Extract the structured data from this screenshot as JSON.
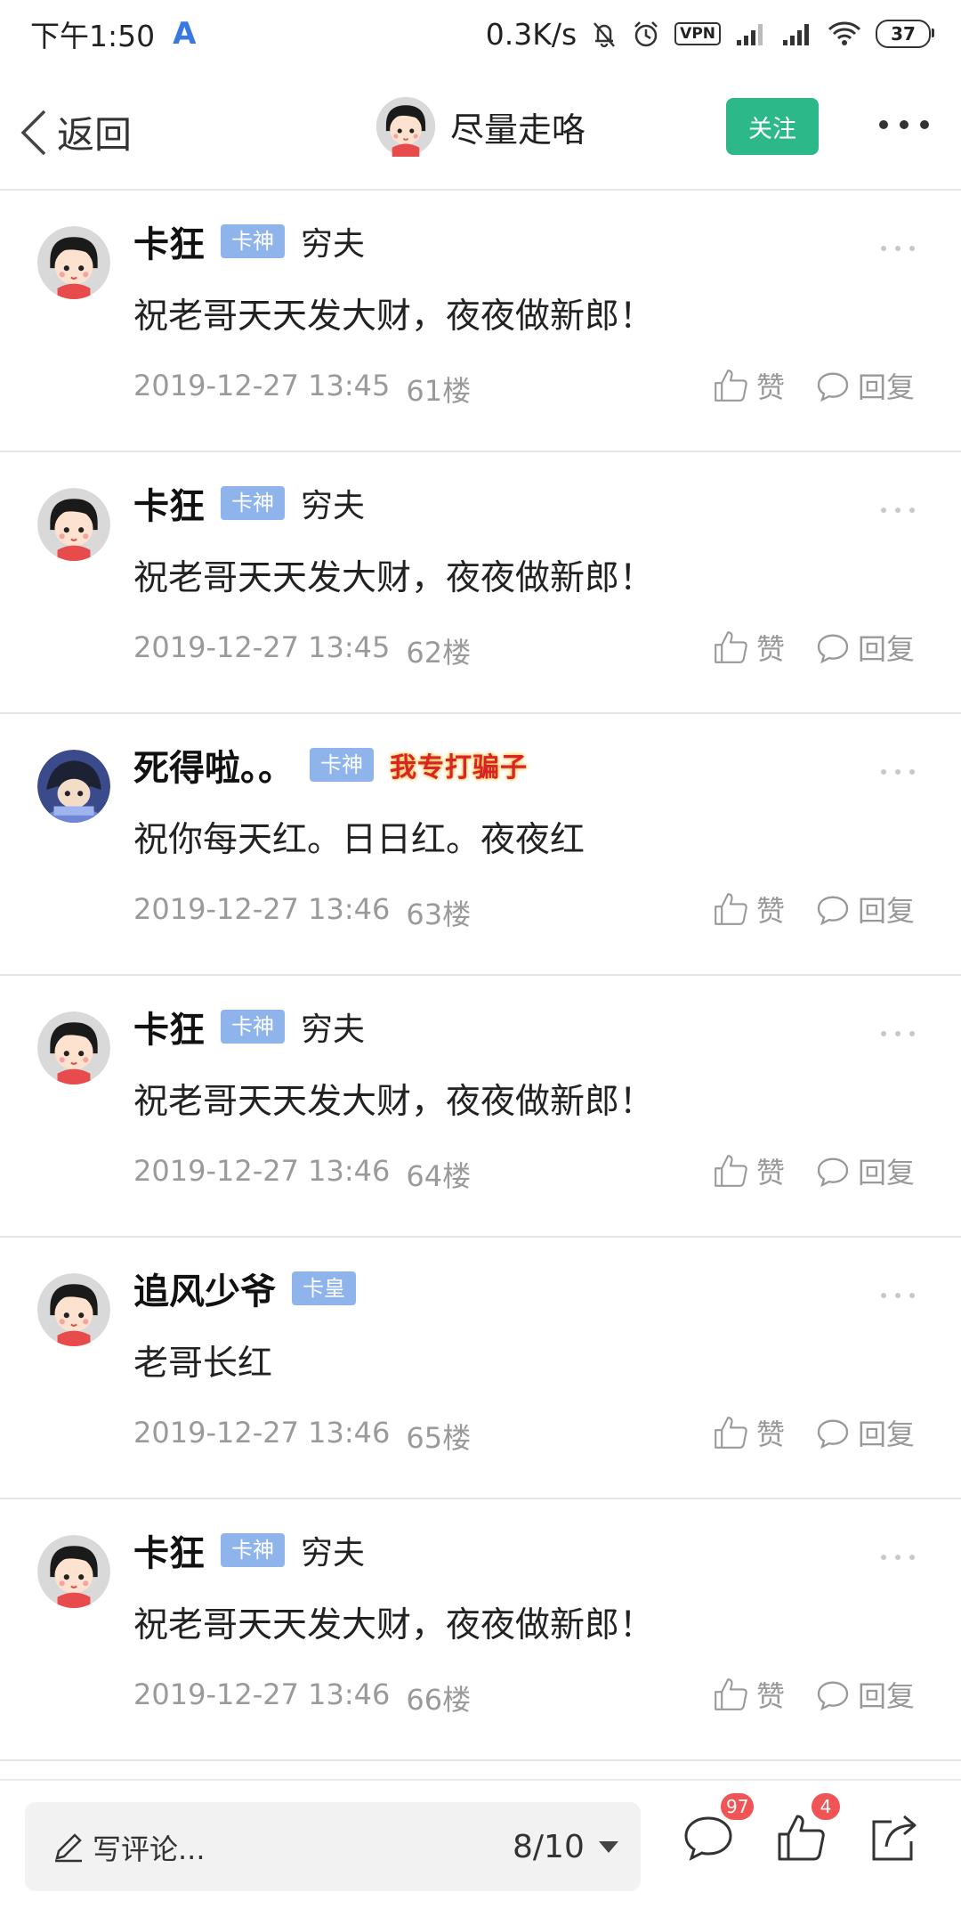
{
  "status_bar": {
    "time": "下午1:50",
    "app_icon": "A",
    "net_speed": "0.3K/s",
    "vpn": "VPN",
    "battery": "37"
  },
  "nav": {
    "back_label": "返回",
    "title": "尽量走咯",
    "follow_label": "关注"
  },
  "comments": [
    {
      "name": "卡狂",
      "badge": "卡神",
      "title": "穷夫",
      "text": "祝老哥天天发大财，夜夜做新郎！",
      "time": "2019-12-27 13:45",
      "floor": "61楼",
      "like": "赞",
      "reply": "回复"
    },
    {
      "name": "卡狂",
      "badge": "卡神",
      "title": "穷夫",
      "text": "祝老哥天天发大财，夜夜做新郎！",
      "time": "2019-12-27 13:45",
      "floor": "62楼",
      "like": "赞",
      "reply": "回复"
    },
    {
      "name": "死得啦。。",
      "badge": "卡神",
      "title": "我专打骗子",
      "text": "祝你每天红。日日红。夜夜红",
      "time": "2019-12-27 13:46",
      "floor": "63楼",
      "like": "赞",
      "reply": "回复"
    },
    {
      "name": "卡狂",
      "badge": "卡神",
      "title": "穷夫",
      "text": "祝老哥天天发大财，夜夜做新郎！",
      "time": "2019-12-27 13:46",
      "floor": "64楼",
      "like": "赞",
      "reply": "回复"
    },
    {
      "name": "追风少爷",
      "badge": "卡皇",
      "title": "",
      "text": "老哥长红",
      "time": "2019-12-27 13:46",
      "floor": "65楼",
      "like": "赞",
      "reply": "回复"
    },
    {
      "name": "卡狂",
      "badge": "卡神",
      "title": "穷夫",
      "text": "祝老哥天天发大财，夜夜做新郎！",
      "time": "2019-12-27 13:46",
      "floor": "66楼",
      "like": "赞",
      "reply": "回复"
    }
  ],
  "bottom": {
    "write_placeholder": "写评论...",
    "page": "8/10",
    "comment_count": "97",
    "like_count": "4"
  }
}
